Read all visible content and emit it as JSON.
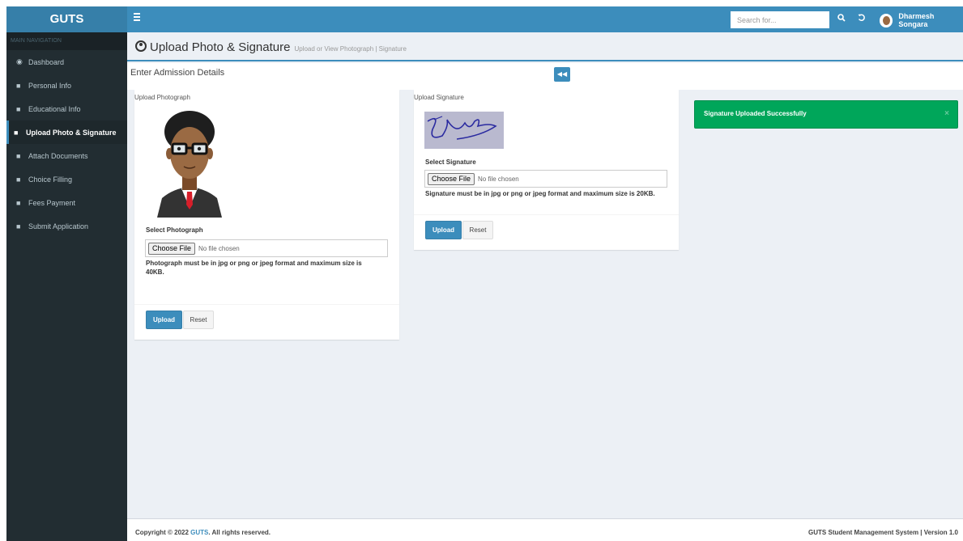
{
  "app": {
    "logo": "GUTS"
  },
  "header": {
    "search_placeholder": "Search for...",
    "user_name": "Dharmesh Songara"
  },
  "sidebar": {
    "header": "MAIN NAVIGATION",
    "items": [
      {
        "label": "Dashboard",
        "icon": "dashboard-icon"
      },
      {
        "label": "Personal Info",
        "icon": "users-icon"
      },
      {
        "label": "Educational Info",
        "icon": "users-icon"
      },
      {
        "label": "Upload Photo & Signature",
        "icon": "users-icon",
        "active": true
      },
      {
        "label": "Attach Documents",
        "icon": "users-icon"
      },
      {
        "label": "Choice Filling",
        "icon": "users-icon"
      },
      {
        "label": "Fees Payment",
        "icon": "users-icon"
      },
      {
        "label": "Submit Application",
        "icon": "users-icon"
      }
    ]
  },
  "page": {
    "title": "Upload Photo & Signature",
    "subtitle": "Upload or View Photograph | Signature",
    "section_title": "Enter Admission Details"
  },
  "photo_panel": {
    "title": "Upload Photograph",
    "select_label": "Select Photograph",
    "choose_label": "Choose File",
    "file_status": "No file chosen",
    "help_line1": "Photograph must be in jpg or png or jpeg format and maximum size is",
    "help_line2": "40KB.",
    "upload_label": "Upload",
    "reset_label": "Reset"
  },
  "signature_panel": {
    "title": "Upload Signature",
    "select_label": "Select Signature",
    "choose_label": "Choose File",
    "file_status": "No file chosen",
    "help": "Signature must be in jpg or png or jpeg format and maximum size is 20KB.",
    "upload_label": "Upload",
    "reset_label": "Reset"
  },
  "alert": {
    "message": "Signature Uploaded Successfully",
    "close": "×"
  },
  "footer": {
    "copyright_prefix": "Copyright © 2022 ",
    "brand": "GUTS",
    "copyright_suffix": ". All rights reserved.",
    "right": "GUTS Student Management System | Version 1.0"
  },
  "colors": {
    "primary": "#3c8dbc",
    "sidebar_bg": "#222d32",
    "success": "#00a65a"
  }
}
